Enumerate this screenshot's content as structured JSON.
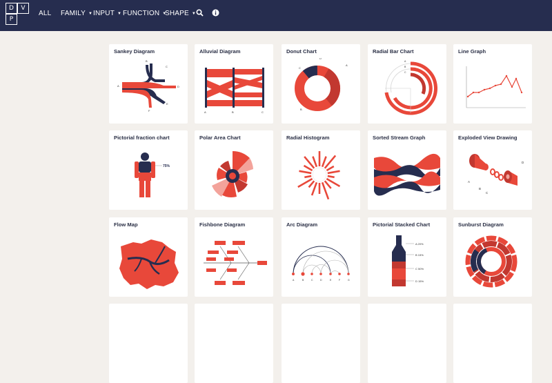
{
  "nav": {
    "logo_letters": [
      "D",
      "V",
      "P",
      ""
    ],
    "items": [
      {
        "label": "ALL",
        "has_caret": false
      },
      {
        "label": "FAMILY",
        "has_caret": true
      },
      {
        "label": "INPUT",
        "has_caret": true
      },
      {
        "label": "FUNCTION",
        "has_caret": true
      },
      {
        "label": "SHAPE",
        "has_caret": true
      }
    ],
    "icons": [
      "search-icon",
      "info-icon"
    ],
    "colors": {
      "background": "#262d4f",
      "text": "#ffffff"
    }
  },
  "page": {
    "background": "#f3f0ec"
  },
  "cards": [
    {
      "title": "Sankey Diagram",
      "labels": [
        "A",
        "B",
        "C",
        "D",
        "E",
        "F"
      ]
    },
    {
      "title": "Alluvial Diagram",
      "labels": [
        "A",
        "B",
        "C"
      ]
    },
    {
      "title": "Donut Chart",
      "labels": [
        "A",
        "B",
        "C",
        "D"
      ]
    },
    {
      "title": "Radial Bar Chart",
      "labels": [
        "A",
        "B",
        "C"
      ]
    },
    {
      "title": "Line Graph",
      "labels": []
    },
    {
      "title": "Pictorial fraction chart",
      "labels": [
        "75%"
      ]
    },
    {
      "title": "Polar Area Chart",
      "labels": []
    },
    {
      "title": "Radial Histogram",
      "labels": []
    },
    {
      "title": "Sorted Stream Graph",
      "labels": []
    },
    {
      "title": "Exploded View Drawing",
      "labels": [
        "A",
        "B",
        "C",
        "D"
      ]
    },
    {
      "title": "Flow Map",
      "labels": []
    },
    {
      "title": "Fishbone Diagram",
      "labels": []
    },
    {
      "title": "Arc Diagram",
      "labels": [
        "A",
        "B",
        "C",
        "D",
        "E",
        "F",
        "G"
      ]
    },
    {
      "title": "Pictorial Stacked Chart",
      "labels": [
        "A 20%",
        "B 15%",
        "C 50%",
        "D 15%"
      ]
    },
    {
      "title": "Sunburst Diagram",
      "labels": []
    }
  ],
  "colors": {
    "accent_red": "#e8483a",
    "dark_navy": "#262d4f",
    "light_red": "#f3a39b"
  }
}
